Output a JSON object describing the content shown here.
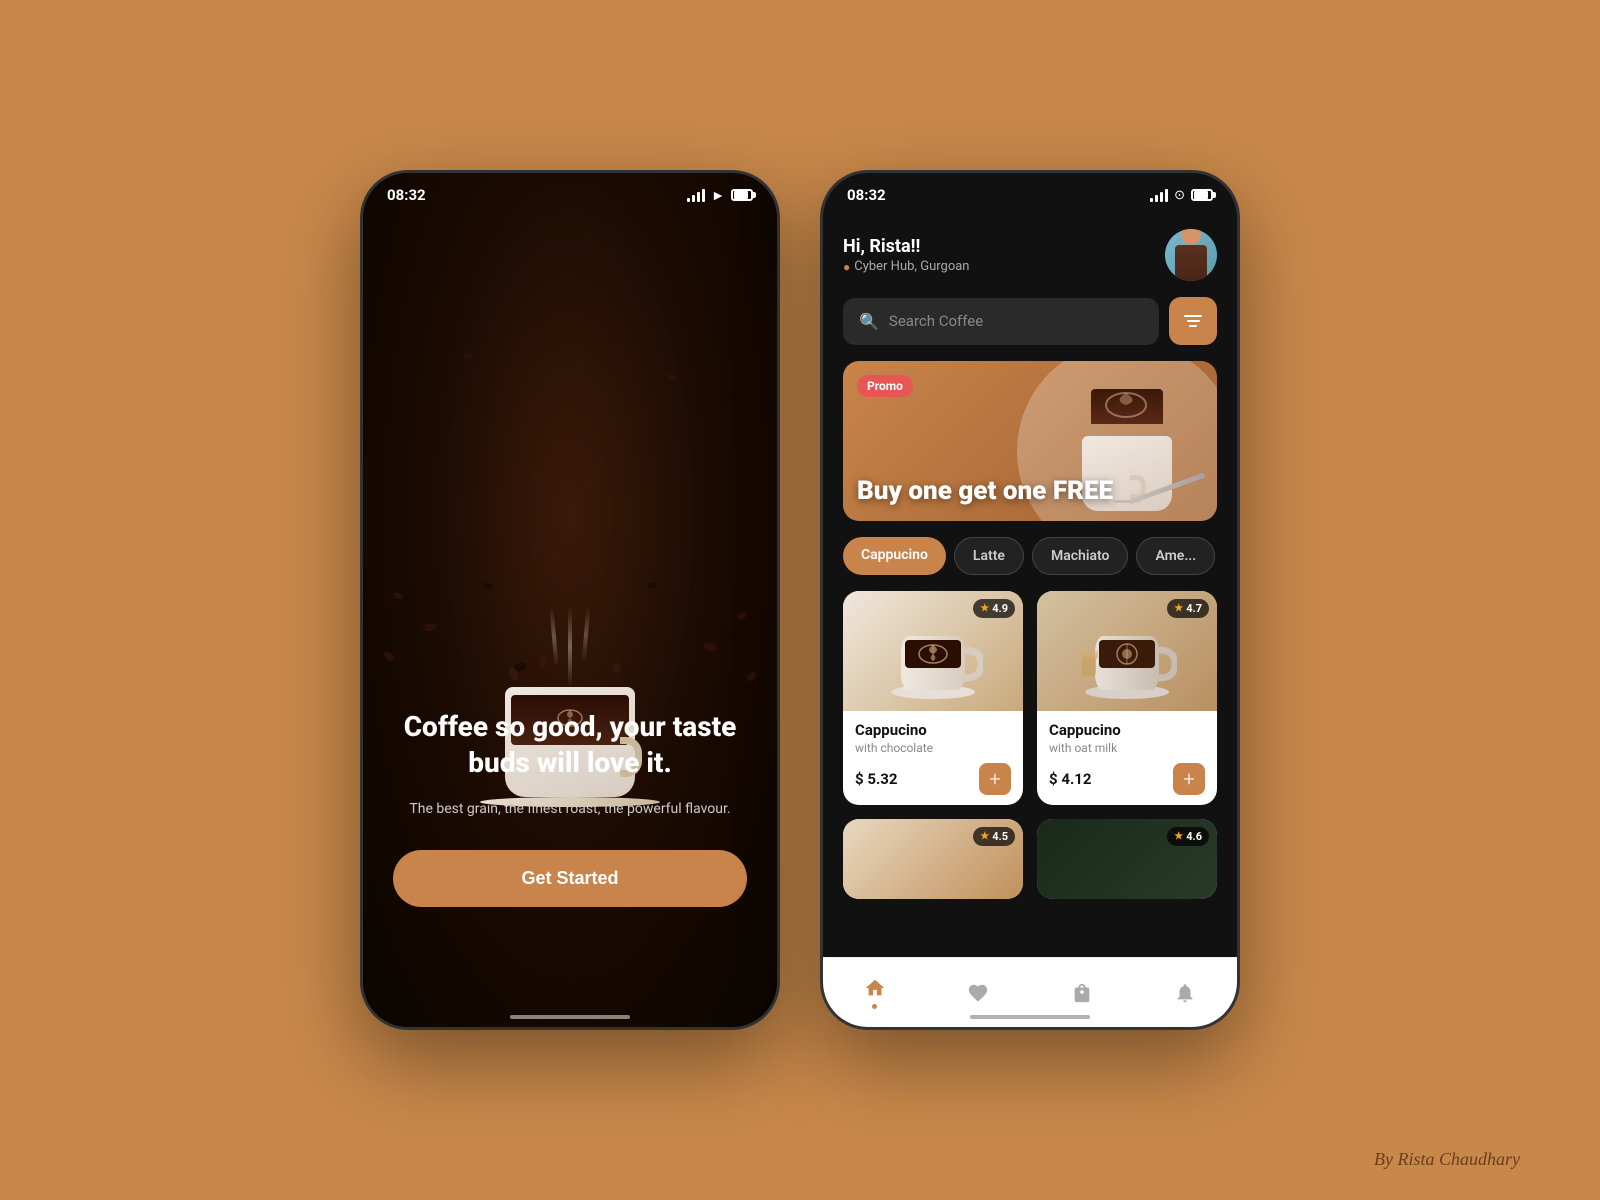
{
  "background_color": "#C8884A",
  "phone1": {
    "status_time": "08:32",
    "splash_title": "Coffee so good, your taste buds will love it.",
    "splash_subtitle": "The best grain, the finest roast, the powerful flavour.",
    "get_started_label": "Get Started"
  },
  "phone2": {
    "status_time": "08:32",
    "greeting": "Hi, Rista!!",
    "location": "Cyber Hub, Gurgoan",
    "search_placeholder": "Search Coffee",
    "promo_badge": "Promo",
    "promo_title": "Buy one get one FREE",
    "categories": [
      {
        "label": "Cappucino",
        "active": true
      },
      {
        "label": "Latte",
        "active": false
      },
      {
        "label": "Machiato",
        "active": false
      },
      {
        "label": "Ame...",
        "active": false
      }
    ],
    "products": [
      {
        "name": "Cappucino",
        "description": "with chocolate",
        "price": "$ 5.32",
        "rating": "4.9"
      },
      {
        "name": "Cappucino",
        "description": "with oat milk",
        "price": "$ 4.12",
        "rating": "4.7"
      },
      {
        "name": "",
        "description": "",
        "price": "",
        "rating": "4.5"
      },
      {
        "name": "",
        "description": "",
        "price": "",
        "rating": "4.6"
      }
    ],
    "nav_items": [
      "home",
      "heart",
      "bag",
      "bell"
    ],
    "watermark": "By Rista Chaudhary"
  }
}
